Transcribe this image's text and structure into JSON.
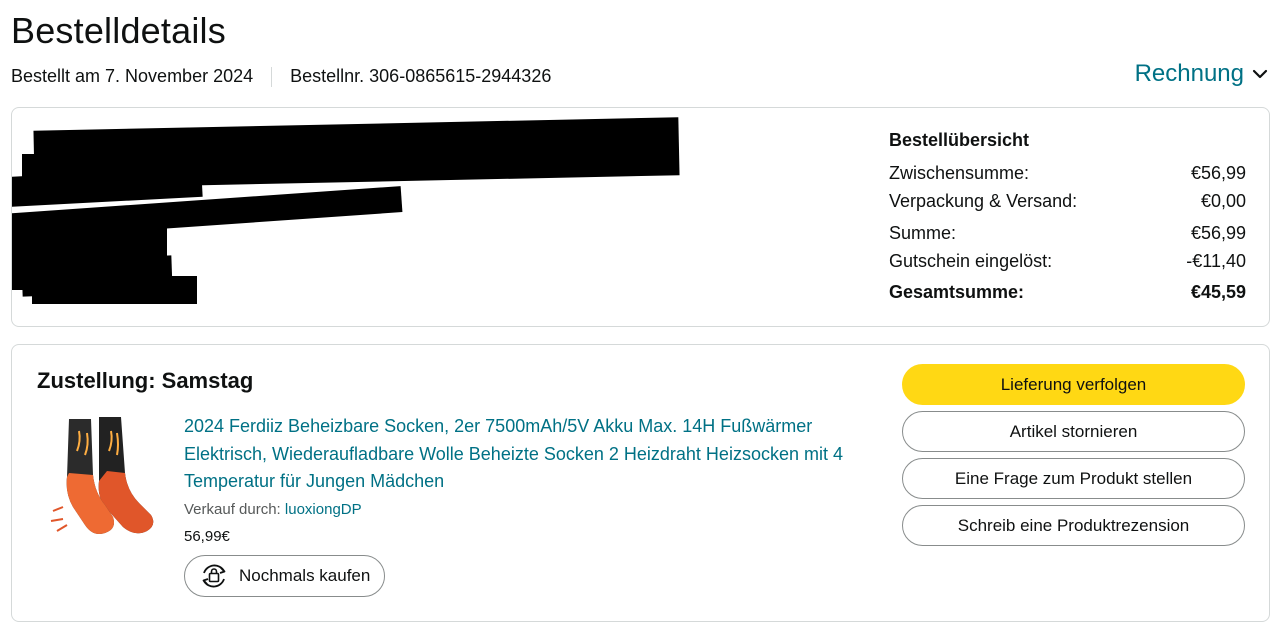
{
  "header": {
    "title": "Bestelldetails",
    "order_date": "Bestellt am 7. November 2024",
    "order_number": "Bestellnr. 306-0865615-2944326",
    "invoice_label": "Rechnung"
  },
  "summary": {
    "heading": "Bestellübersicht",
    "rows": [
      {
        "label": "Zwischensumme:",
        "value": "€56,99"
      },
      {
        "label": "Verpackung & Versand:",
        "value": "€0,00"
      },
      {
        "label": "Summe:",
        "value": "€56,99"
      },
      {
        "label": "Gutschein eingelöst:",
        "value": "-€11,40"
      },
      {
        "label": "Gesamtsumme:",
        "value": "€45,59"
      }
    ]
  },
  "delivery": {
    "title": "Zustellung: Samstag",
    "product": {
      "name": "2024 Ferdiiz Beheizbare Socken, 2er 7500mAh/5V Akku Max. 14H Fußwärmer Elektrisch, Wiederaufladbare Wolle Beheizte Socken 2 Heizdraht Heizsocken mit 4 Temperatur für Jungen Mädchen",
      "seller_prefix": "Verkauf durch:",
      "seller_name": "luoxiongDP",
      "price": "56,99€",
      "rebuy_label": "Nochmals kaufen",
      "image_icon": "heated-socks-image"
    },
    "actions": {
      "track": "Lieferung verfolgen",
      "cancel": "Artikel stornieren",
      "question": "Eine Frage zum Produkt stellen",
      "review": "Schreib eine Produktrezension"
    }
  },
  "colors": {
    "link": "#007185",
    "primary_button": "#ffd814",
    "border": "#d5d9d9"
  }
}
